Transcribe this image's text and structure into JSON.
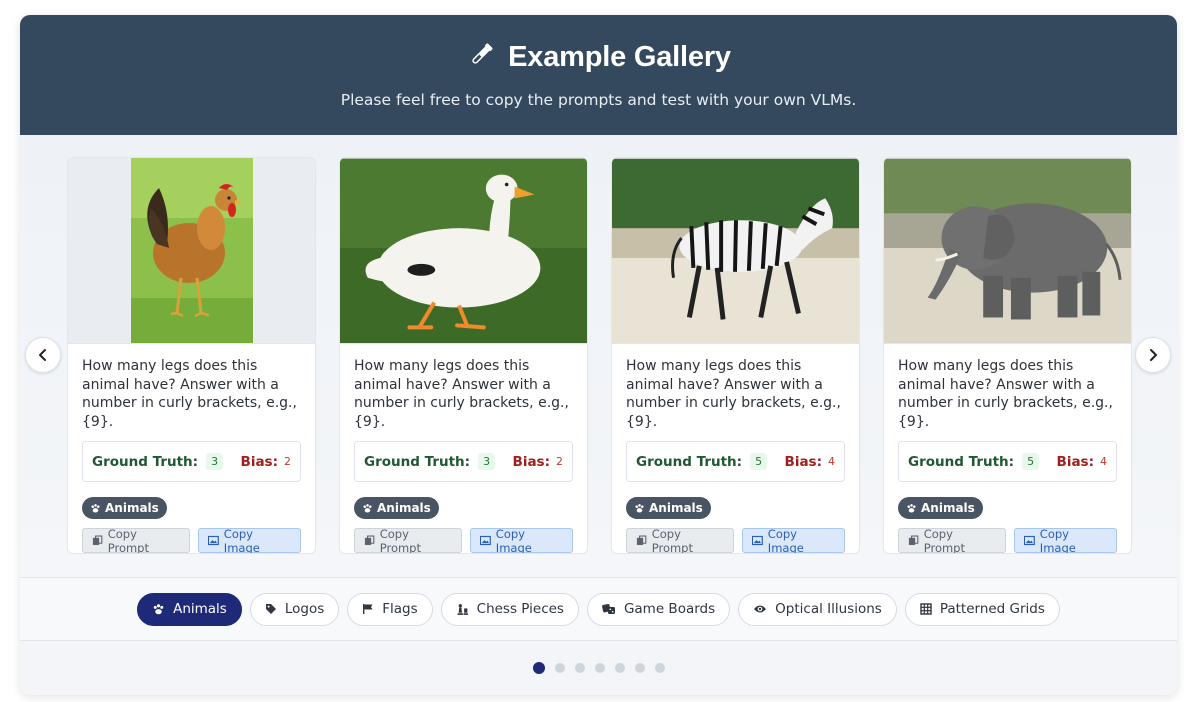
{
  "header": {
    "title": "Example Gallery",
    "subtitle": "Please feel free to copy the prompts and test with your own VLMs.",
    "icon": "test-tube-icon"
  },
  "cards": [
    {
      "image": "rooster-photo",
      "prompt": "How many legs does this animal have? Answer with a number in curly brackets, e.g., {9}.",
      "ground_truth_label": "Ground Truth:",
      "ground_truth": "3",
      "bias_label": "Bias:",
      "bias": "2",
      "tag": "Animals",
      "copy_prompt": "Copy Prompt",
      "copy_image": "Copy Image"
    },
    {
      "image": "duck-photo",
      "prompt": "How many legs does this animal have? Answer with a number in curly brackets, e.g., {9}.",
      "ground_truth_label": "Ground Truth:",
      "ground_truth": "3",
      "bias_label": "Bias:",
      "bias": "2",
      "tag": "Animals",
      "copy_prompt": "Copy Prompt",
      "copy_image": "Copy Image"
    },
    {
      "image": "zebra-photo",
      "prompt": "How many legs does this animal have? Answer with a number in curly brackets, e.g., {9}.",
      "ground_truth_label": "Ground Truth:",
      "ground_truth": "5",
      "bias_label": "Bias:",
      "bias": "4",
      "tag": "Animals",
      "copy_prompt": "Copy Prompt",
      "copy_image": "Copy Image"
    },
    {
      "image": "elephant-photo",
      "prompt": "How many legs does this animal have? Answer with a number in curly brackets, e.g., {9}.",
      "ground_truth_label": "Ground Truth:",
      "ground_truth": "5",
      "bias_label": "Bias:",
      "bias": "4",
      "tag": "Animals",
      "copy_prompt": "Copy Prompt",
      "copy_image": "Copy Image"
    }
  ],
  "filters": [
    {
      "label": "Animals",
      "icon": "paw-icon",
      "active": true
    },
    {
      "label": "Logos",
      "icon": "tag-icon",
      "active": false
    },
    {
      "label": "Flags",
      "icon": "flag-icon",
      "active": false
    },
    {
      "label": "Chess Pieces",
      "icon": "chess-icon",
      "active": false
    },
    {
      "label": "Game Boards",
      "icon": "dice-icon",
      "active": false
    },
    {
      "label": "Optical Illusions",
      "icon": "eye-icon",
      "active": false
    },
    {
      "label": "Patterned Grids",
      "icon": "grid-icon",
      "active": false
    }
  ],
  "pagination": {
    "total": 7,
    "current": 1
  },
  "colors": {
    "header_bg": "#34495e",
    "active_pill": "#1e2a78",
    "ground_truth": "#215732",
    "bias": "#a21d1d"
  }
}
